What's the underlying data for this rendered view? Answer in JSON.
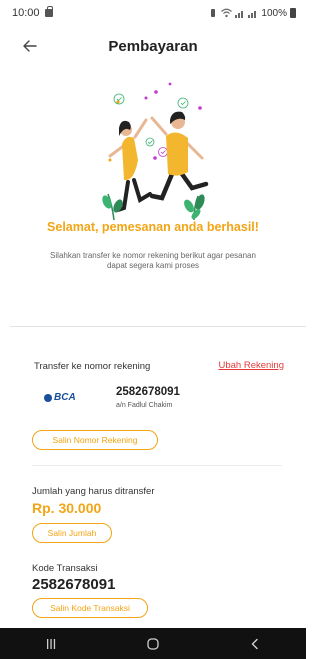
{
  "status_bar": {
    "time": "10:00",
    "battery": "100%"
  },
  "app_bar": {
    "title": "Pembayaran"
  },
  "success": {
    "title": "Selamat, pemesanan anda berhasil!",
    "description": "Silahkan transfer ke nomor rekening berikut agar pesanan dapat segera kami proses"
  },
  "transfer": {
    "label": "Transfer ke nomor rekening",
    "change_link": "Ubah Rekening",
    "bank": "BCA",
    "account_number": "2582678091",
    "account_holder": "a/n Fadlul Chakim",
    "copy_button": "Salin Nomor Rekening"
  },
  "amount": {
    "label": "Jumlah yang harus ditransfer",
    "value": "Rp. 30.000",
    "copy_button": "Salin Jumlah"
  },
  "transaction": {
    "label": "Kode Transaksi",
    "code": "2582678091",
    "copy_button": "Salin Kode Transaksi"
  },
  "colors": {
    "accent": "#f2a515",
    "link": "#e23b3b",
    "bank": "#1a4f9c"
  }
}
